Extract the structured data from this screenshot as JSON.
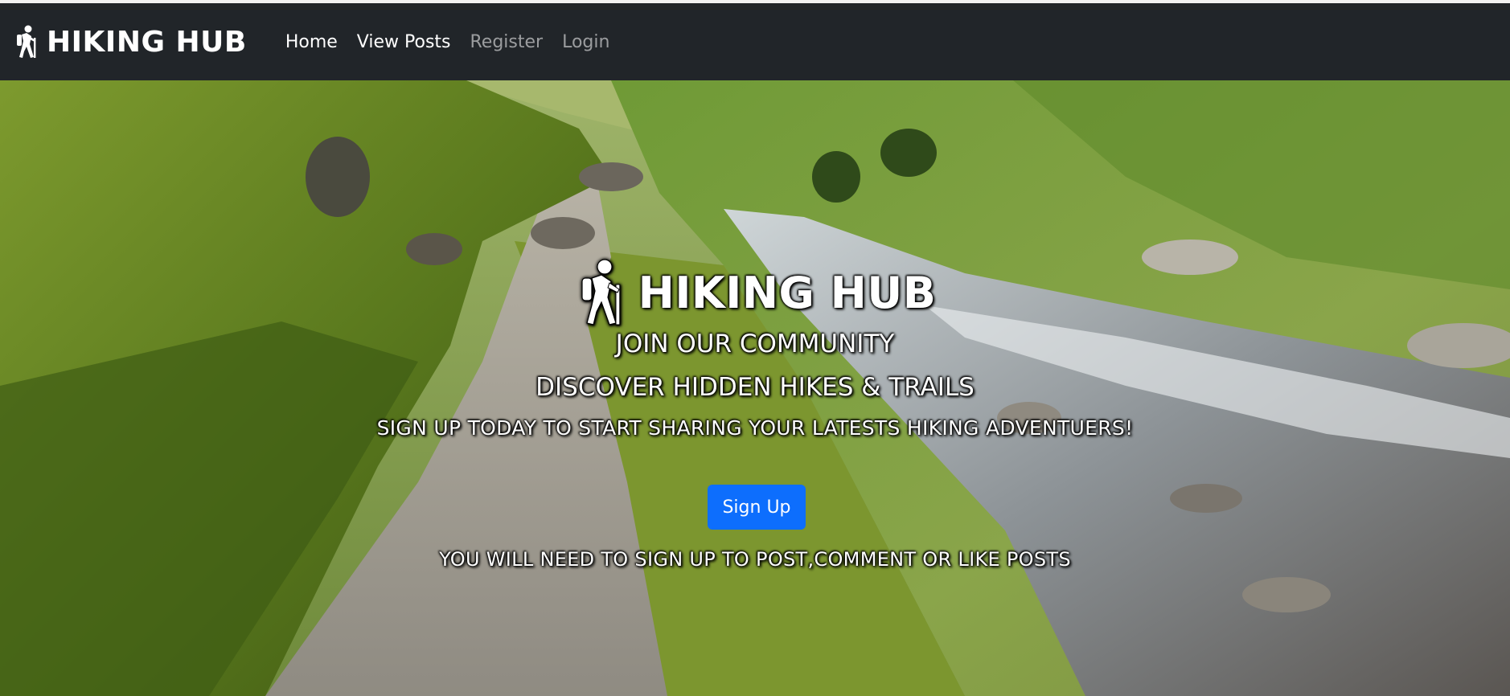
{
  "navbar": {
    "brand_icon": "hiker-icon",
    "brand": "HIKING HUB",
    "links": [
      {
        "label": "Home",
        "state": "active"
      },
      {
        "label": "View Posts",
        "state": "active"
      },
      {
        "label": "Register",
        "state": "muted"
      },
      {
        "label": "Login",
        "state": "muted"
      }
    ]
  },
  "hero": {
    "background": "mountain-valley-stream-photo",
    "title_icon": "hiker-icon",
    "title": "HIKING HUB",
    "line1": "JOIN OUR COMMUNITY",
    "line2": "DISCOVER HIDDEN HIKES & TRAILS",
    "line3": "SIGN UP TODAY TO START SHARING YOUR LATESTS HIKING ADVENTUERS!",
    "signup_label": "Sign Up",
    "notice": "YOU WILL NEED TO SIGN UP TO POST,COMMENT OR LIKE POSTS"
  },
  "colors": {
    "navbar_bg": "#212529",
    "primary_button": "#0d6efd",
    "link_muted": "rgba(255,255,255,0.55)"
  }
}
